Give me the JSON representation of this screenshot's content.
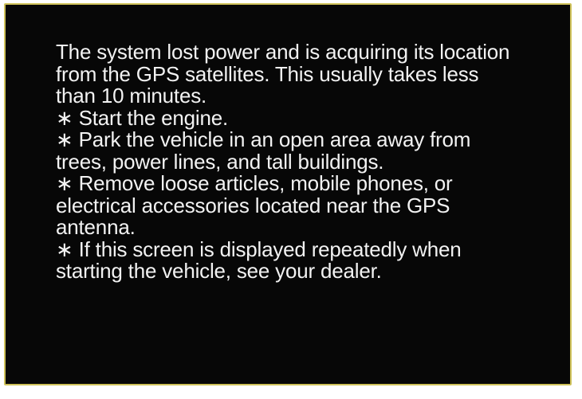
{
  "colors": {
    "background": "#070707",
    "border": "#cfc25a",
    "text": "#f2f2f2"
  },
  "message": {
    "lines": [
      "The system lost power and is acquiring its location",
      "from the GPS satellites. This usually takes less",
      "than 10 minutes.",
      "∗ Start the engine.",
      "∗ Park the vehicle in an open area away from",
      "trees, power lines, and tall buildings.",
      "∗ Remove loose articles, mobile phones, or",
      "electrical accessories located near the GPS",
      "antenna.",
      "∗ If this screen is displayed repeatedly when",
      "starting the vehicle, see your dealer."
    ]
  }
}
